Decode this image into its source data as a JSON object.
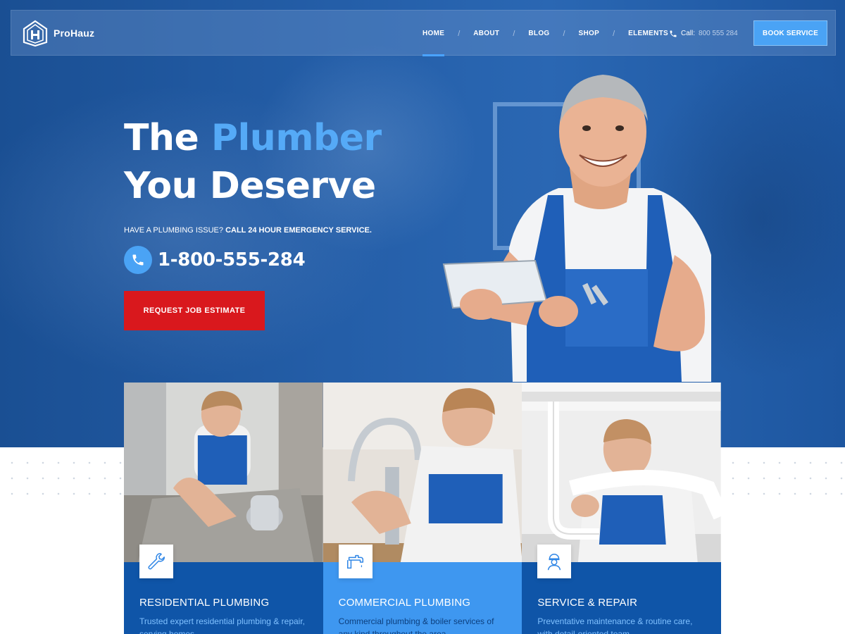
{
  "brand": {
    "name": "ProHauz"
  },
  "nav": {
    "items": [
      {
        "label": "HOME",
        "active": true
      },
      {
        "label": "ABOUT",
        "active": false
      },
      {
        "label": "BLOG",
        "active": false
      },
      {
        "label": "SHOP",
        "active": false
      },
      {
        "label": "ELEMENTS",
        "active": false
      }
    ],
    "call_label": "Call:",
    "call_number": "800 555 284",
    "cta_label": "BOOK SERVICE"
  },
  "hero": {
    "headline_word1": "The",
    "headline_accent": "Plumber",
    "headline_line2": "You Deserve",
    "subline_prefix": "HAVE A PLUMBING ISSUE?",
    "subline_bold": "CALL 24 HOUR EMERGENCY SERVICE.",
    "phone": "1-800-555-284",
    "cta_label": "REQUEST JOB ESTIMATE"
  },
  "services": [
    {
      "title": "RESIDENTIAL PLUMBING",
      "text": "Trusted expert residential plumbing & repair, serving homes",
      "icon": "wrench-icon"
    },
    {
      "title": "COMMERCIAL PLUMBING",
      "text": "Commercial plumbing & boiler services of any kind throughout the area",
      "icon": "faucet-icon"
    },
    {
      "title": "SERVICE & REPAIR",
      "text": "Preventative maintenance & routine care, with detail-oriented team",
      "icon": "worker-icon"
    }
  ],
  "colors": {
    "hero_blue": "#245ea8",
    "accent_blue": "#4aa3f5",
    "headline_accent": "#55aaf7",
    "cta_red": "#d9181d",
    "card_dark": "#0f55a8",
    "card_light": "#3e97f0"
  }
}
